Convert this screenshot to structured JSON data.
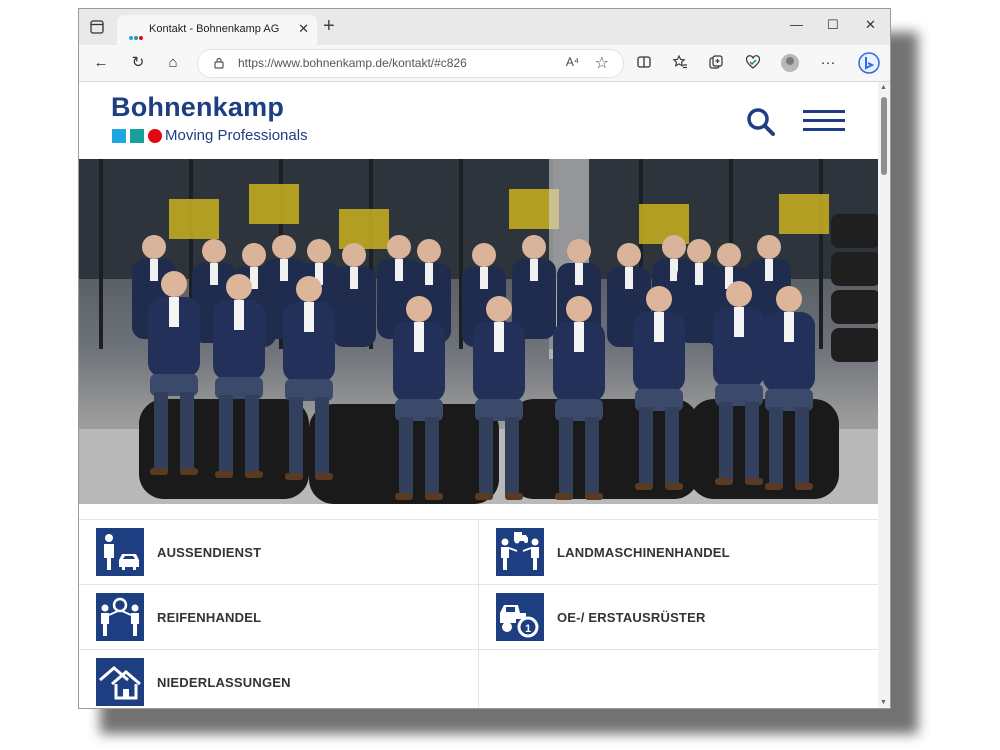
{
  "browser": {
    "tab_title": "Kontakt - Bohnenkamp AG",
    "tab_close": "✕",
    "new_tab": "+",
    "url": "https://www.bohnenkamp.de/kontakt/#c826",
    "read_aloud": "A⁴",
    "favorite_glyph": "☆",
    "window_controls": {
      "minimize": "—",
      "maximize": "☐",
      "close": "✕"
    },
    "nav": {
      "back": "←",
      "reload": "↻",
      "home": "⌂",
      "more": "···"
    }
  },
  "site": {
    "logo_name": "Bohnenkamp",
    "logo_tagline": "Moving Professionals",
    "logo_colors": [
      "#1fa6de",
      "#18a09a",
      "#e30613"
    ],
    "brand_color": "#1d3f82"
  },
  "categories": [
    {
      "label": "AUSSENDIENST",
      "icon": "field-service-icon"
    },
    {
      "label": "LANDMASCHINENHANDEL",
      "icon": "agri-machinery-trade-icon"
    },
    {
      "label": "REIFENHANDEL",
      "icon": "tyre-trade-icon"
    },
    {
      "label": "OE-/ ERSTAUSRÜSTER",
      "icon": "oem-icon"
    },
    {
      "label": "NIEDERLASSUNGEN",
      "icon": "branches-icon"
    }
  ]
}
